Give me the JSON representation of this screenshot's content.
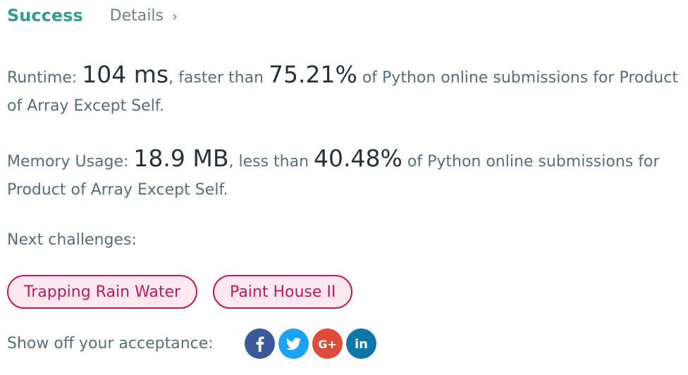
{
  "header": {
    "status": "Success",
    "details_label": "Details",
    "details_chevron": "›"
  },
  "runtime": {
    "label": "Runtime: ",
    "value": "104 ms",
    "comparison": ", faster than ",
    "percent": "75.21%",
    "suffix": " of Python online submissions for Product of Array Except Self."
  },
  "memory": {
    "label": "Memory Usage: ",
    "value": "18.9 MB",
    "comparison": ", less than ",
    "percent": "40.48%",
    "suffix": " of Python online submissions for Product of Array Except Self."
  },
  "next": {
    "label": "Next challenges:",
    "items": [
      {
        "label": "Trapping Rain Water"
      },
      {
        "label": "Paint House II"
      }
    ]
  },
  "share": {
    "label": "Show off your acceptance:",
    "icons": [
      {
        "name": "facebook-icon",
        "glyph": "f",
        "color": "#3b5998"
      },
      {
        "name": "twitter-icon",
        "glyph": "",
        "color": "#1da1f2"
      },
      {
        "name": "google-plus-icon",
        "glyph": "G+",
        "color": "#dd4b39"
      },
      {
        "name": "linkedin-icon",
        "glyph": "in",
        "color": "#0e76a8"
      }
    ]
  },
  "colors": {
    "success": "#2f9e8f",
    "chip_border": "#c2185b",
    "chip_bg": "#fde8ef",
    "text": "#546e7a"
  }
}
